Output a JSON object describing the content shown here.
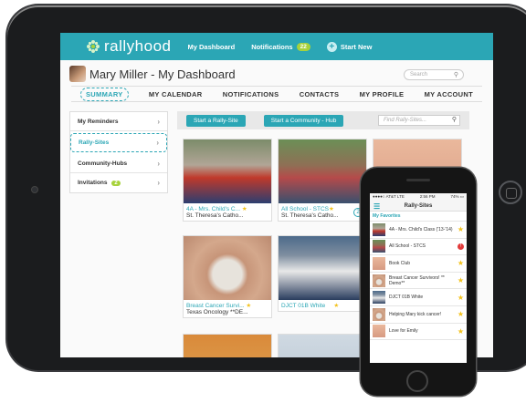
{
  "topbar": {
    "logo_text": "rallyhood",
    "dashboard": "My Dashboard",
    "notifications": "Notifications",
    "notifications_count": "22",
    "start_new": "Start New"
  },
  "header": {
    "title": "Mary Miller - My Dashboard",
    "search_placeholder": "Search"
  },
  "nav": {
    "tabs": [
      "SUMMARY",
      "MY CALENDAR",
      "NOTIFICATIONS",
      "CONTACTS",
      "MY PROFILE",
      "MY ACCOUNT"
    ]
  },
  "sidebar": {
    "items": [
      {
        "label": "My Reminders"
      },
      {
        "label": "Rally-Sites"
      },
      {
        "label": "Community-Hubs"
      },
      {
        "label": "Invitations",
        "count": "2"
      }
    ]
  },
  "main": {
    "start_rally_site": "Start a Rally-Site",
    "start_community_hub": "Start a Community - Hub",
    "find_placeholder": "Find Rally-Sites...",
    "cards": [
      {
        "title": "4A - Mrs. Child's C...",
        "subtitle": "St. Theresa's Catho...",
        "count": ""
      },
      {
        "title": "All School - STCS",
        "subtitle": "St. Theresa's Catho...",
        "count": "2"
      },
      {
        "title": "",
        "subtitle": "",
        "count": ""
      },
      {
        "title": "Breast Cancer Survi...",
        "subtitle": "Texas Oncology **DE...",
        "count": ""
      },
      {
        "title": "DJCT 01B White",
        "subtitle": "",
        "count": ""
      },
      {
        "title": "",
        "subtitle": "",
        "count": ""
      },
      {
        "title": "",
        "subtitle": "",
        "count": ""
      }
    ]
  },
  "phone": {
    "carrier": "●●●●○ AT&T LTE",
    "time": "2:56 PM",
    "battery": "74% ▭",
    "title": "Rally-Sites",
    "section": "My Favorites",
    "rows": [
      {
        "label": "4A - Mrs. Child's Class ('13-'14)",
        "marker": "★"
      },
      {
        "label": "All School - STCS",
        "marker": "!"
      },
      {
        "label": "Book Club",
        "marker": "★"
      },
      {
        "label": "Breast Cancer Survivors! ** Demo**",
        "marker": "★"
      },
      {
        "label": "DJCT 01B White",
        "marker": "★"
      },
      {
        "label": "Helping Mary kick cancer!",
        "marker": "★"
      },
      {
        "label": "Love for Emily",
        "marker": "★"
      }
    ]
  },
  "colors": {
    "brand_teal": "#2ba6b5",
    "badge_green": "#a7d23c",
    "favorite_star": "#f3c21c",
    "alert_red": "#e23b3b"
  }
}
